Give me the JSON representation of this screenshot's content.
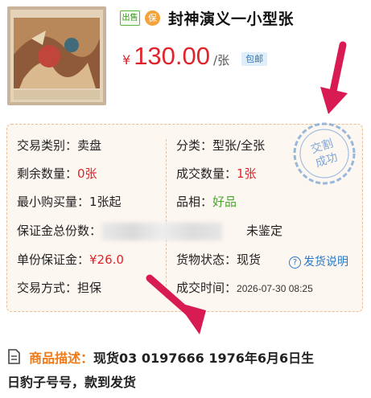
{
  "product": {
    "badge_sell": "出售",
    "badge_guarantee": "保",
    "title": "封神演义一小型张",
    "currency": "¥",
    "price": "130.00",
    "unit": "/张",
    "shipping_tag": "包邮"
  },
  "details": {
    "left": [
      {
        "label": "交易类别：",
        "value": "卖盘"
      },
      {
        "label": "剩余数量：",
        "value": "0张"
      },
      {
        "label": "最小购买量：",
        "value": "1张起"
      },
      {
        "label": "保证金总份数：",
        "value": ""
      },
      {
        "label": "单份保证金：",
        "value": "¥26.0"
      },
      {
        "label": "交易方式：",
        "value": "担保"
      }
    ],
    "right": [
      {
        "label": "分类：",
        "value": "型张/全张"
      },
      {
        "label": "成交数量：",
        "value": "1张"
      },
      {
        "label": "品相：",
        "value": "好品"
      },
      {
        "label": "",
        "value": "未鉴定"
      },
      {
        "label": "货物状态：",
        "value": "现货"
      },
      {
        "label": "成交时间：",
        "value": "2026-07-30 08:25"
      }
    ],
    "shipping_help": "发货说明",
    "stamp_text_1": "交割",
    "stamp_text_2": "成功"
  },
  "description": {
    "label": "商品描述：",
    "text_line1": "现货03 0197666 1976年6月6日生",
    "text_line2": "日豹子号号，款到发货"
  },
  "colors": {
    "price_red": "#e0242b",
    "accent_orange": "#f07a18",
    "link_blue": "#2a79c7",
    "good_green": "#4aa52e",
    "arrow_pink": "#d81b52",
    "stamp_blue": "#7ea7d6"
  }
}
